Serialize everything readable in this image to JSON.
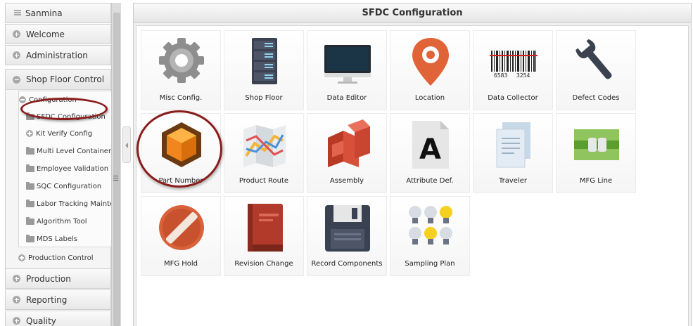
{
  "sidebar": {
    "top_item": "Sanmina",
    "sections": {
      "welcome": "Welcome",
      "administration": "Administration",
      "shop_floor_control": "Shop Floor Control",
      "production": "Production",
      "reporting": "Reporting",
      "quality": "Quality"
    },
    "configuration": {
      "label": "Configuration",
      "items": [
        "SFDC Configuration",
        "Kit Verify Config",
        "Multi Level Container C",
        "Employee Validation",
        "SQC Configuration",
        "Labor Tracking Mainte",
        "Algorithm Tool",
        "MDS Labels"
      ]
    },
    "production_control": "Production Control"
  },
  "main": {
    "title": "SFDC Configuration",
    "tiles": [
      {
        "label": "Misc Config.",
        "icon": "gear-icon"
      },
      {
        "label": "Shop Floor",
        "icon": "server-rack-icon"
      },
      {
        "label": "Data Editor",
        "icon": "monitor-icon"
      },
      {
        "label": "Location",
        "icon": "map-pin-icon"
      },
      {
        "label": "Data Collector",
        "icon": "barcode-icon"
      },
      {
        "label": "Defect Codes",
        "icon": "wrench-icon"
      },
      {
        "label": "Part Number",
        "icon": "cube-icon"
      },
      {
        "label": "Product Route",
        "icon": "route-map-icon"
      },
      {
        "label": "Assembly",
        "icon": "boxes-icon"
      },
      {
        "label": "Attribute Def.",
        "icon": "font-document-icon"
      },
      {
        "label": "Traveler",
        "icon": "documents-icon"
      },
      {
        "label": "MFG Line",
        "icon": "plug-line-icon"
      },
      {
        "label": "MFG Hold",
        "icon": "hold-sign-icon"
      },
      {
        "label": "Revision Change",
        "icon": "book-icon"
      },
      {
        "label": "Record Components",
        "icon": "floppy-disk-icon"
      },
      {
        "label": "Sampling Plan",
        "icon": "light-bulbs-icon"
      }
    ],
    "barcode_digits": [
      "6583",
      "3254"
    ],
    "attribute_glyph": "A"
  },
  "colors": {
    "highlight": "#8b1c1c",
    "cube_orange": "#f0861d",
    "pin_orange": "#e06438"
  }
}
